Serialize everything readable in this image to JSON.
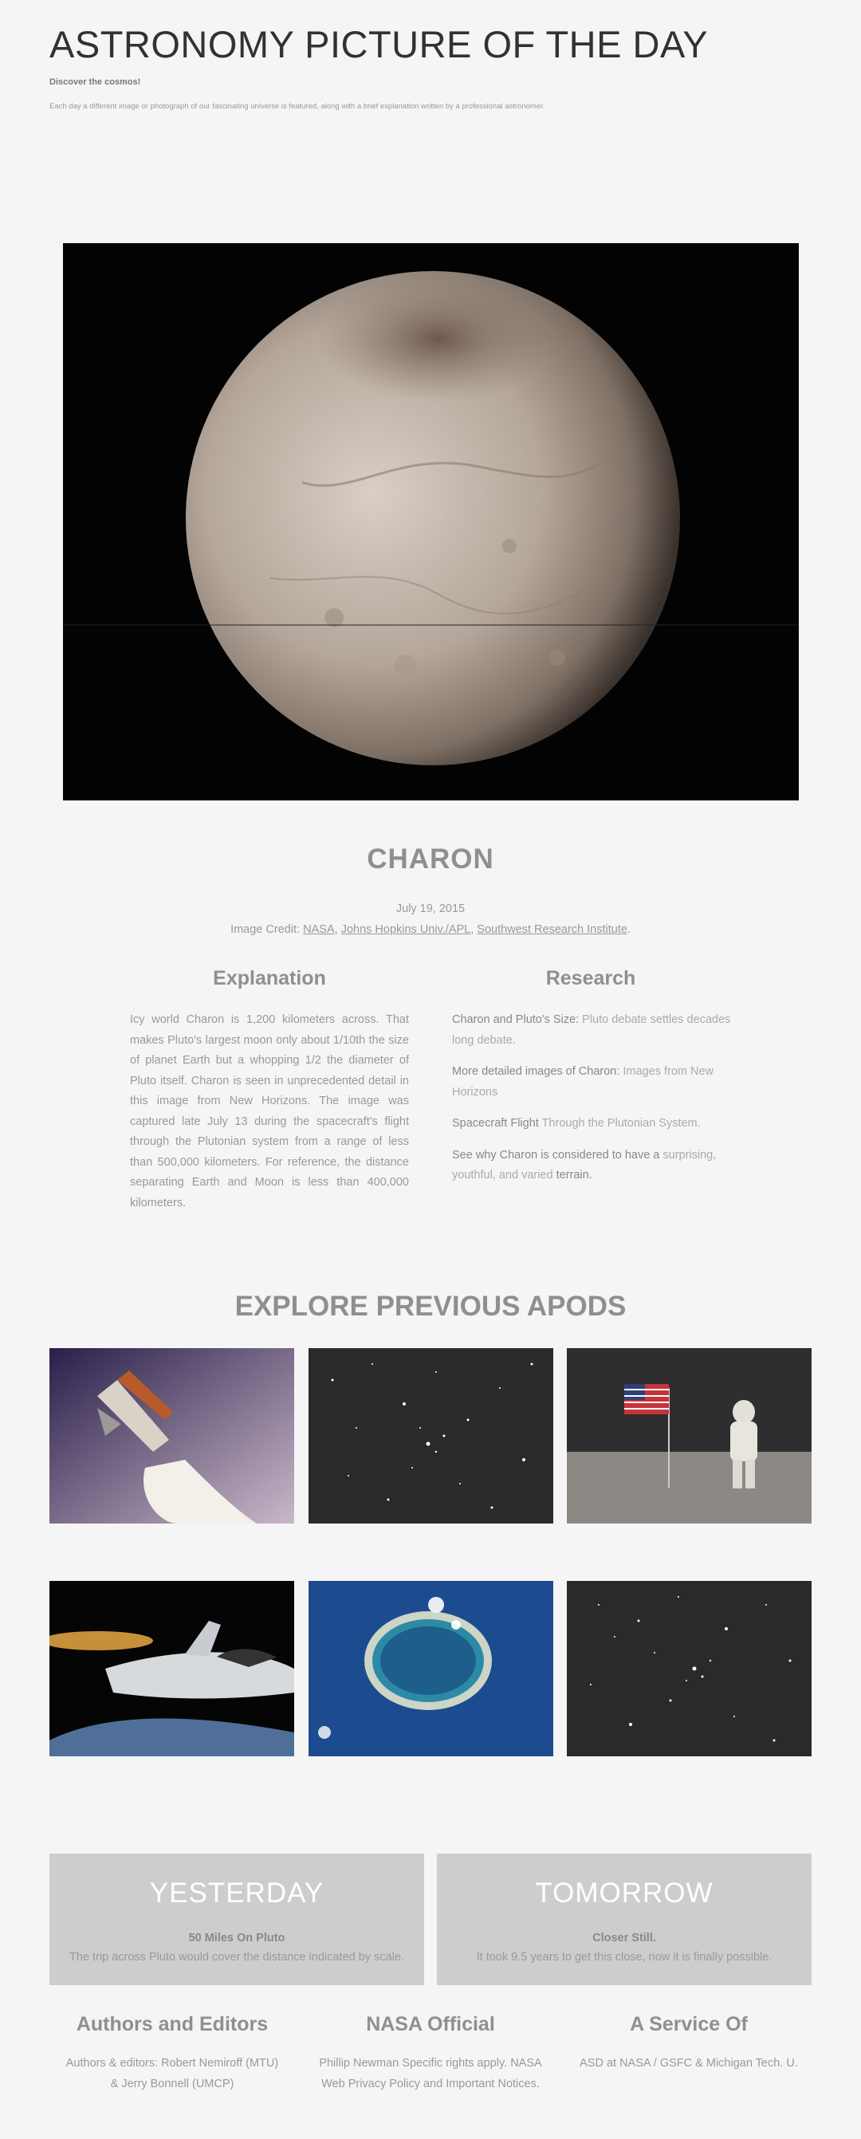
{
  "header": {
    "title": "ASTRONOMY PICTURE OF THE DAY",
    "tagline": "Discover the cosmos!",
    "intro": "Each day a different image or photograph of our fascinating universe is featured, along with a brief explanation written by a professional astronomer."
  },
  "picture": {
    "title": "CHARON",
    "date": "July 19, 2015",
    "credit_prefix": "Image Credit: ",
    "credit_links": [
      "NASA",
      "Johns Hopkins Univ./APL",
      "Southwest Research Institute"
    ],
    "credit_sep": ", ",
    "credit_end": "."
  },
  "explanation": {
    "heading": "Explanation",
    "text": "Icy world Charon is 1,200 kilometers across. That makes Pluto's largest moon only about 1/10th the size of planet Earth but a whopping 1/2 the diameter of Pluto itself. Charon is seen in unprecedented detail in this image from New Horizons. The image was captured late July 13 during the spacecraft's flight through the Plutonian system from a range of less than 500,000 kilometers. For reference, the distance separating Earth and Moon is less than 400,000 kilometers."
  },
  "research": {
    "heading": "Research",
    "items": [
      {
        "lead": "Charon and Pluto's Size:",
        "rest": " Pluto debate settles decades long debate."
      },
      {
        "lead": "More detailed images of Charon:",
        "rest": " Images from New Horizons"
      },
      {
        "lead": "Spacecraft Flight",
        "rest": " Through the Plutonian System."
      },
      {
        "lead": "See why Charon is considered to have a",
        "rest": " surprising, youthful, and varied ",
        "tail": "terrain."
      }
    ]
  },
  "explore": {
    "title": "EXPLORE PREVIOUS APODS",
    "thumbs": [
      "space-shuttle-launch",
      "star-field",
      "apollo-astronaut-flag",
      "spaceplane",
      "atoll-from-orbit",
      "star-cluster"
    ]
  },
  "nav": {
    "yesterday": {
      "heading": "YESTERDAY",
      "sub": "50 Miles On Pluto",
      "desc": "The trip across Pluto would cover the distance indicated by scale."
    },
    "tomorrow": {
      "heading": "TOMORROW",
      "sub": "Closer Still.",
      "desc": "It took 9.5 years to get this close, now it is finally possible."
    }
  },
  "footer": {
    "authors": {
      "heading": "Authors and Editors",
      "text": "Authors & editors: Robert Nemiroff (MTU) & Jerry Bonnell (UMCP)"
    },
    "official": {
      "heading": "NASA Official",
      "text": "Phillip Newman Specific rights apply. NASA Web Privacy Policy and Important Notices."
    },
    "service": {
      "heading": "A Service Of",
      "text": "ASD at NASA / GSFC & Michigan Tech. U."
    }
  }
}
